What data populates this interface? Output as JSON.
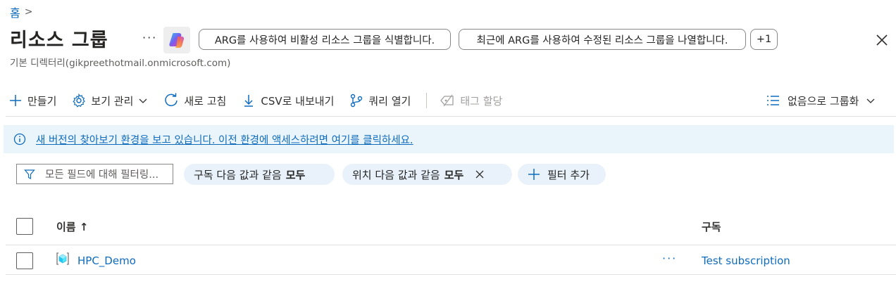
{
  "breadcrumb": {
    "home": "홈",
    "separator": ">"
  },
  "header": {
    "title": "리소스 그룹",
    "more": "···",
    "subtitle": "기본 디렉터리(gikpreethotmail.onmicrosoft.com)",
    "suggestions": [
      "ARG를 사용하여 비활성 리소스 그룹을 식별합니다.",
      "최근에 ARG를 사용하여 수정된 리소스 그룹을 나열합니다.",
      "+1"
    ]
  },
  "toolbar": {
    "create": "만들기",
    "manage_view": "보기 관리",
    "refresh": "새로 고침",
    "export_csv": "CSV로 내보내기",
    "open_query": "쿼리 열기",
    "assign_tags": "태그 할당",
    "group_by": "없음으로 그룹화"
  },
  "banner": {
    "message": "새 버전의 찾아보기 환경을 보고 있습니다. 이전 환경에 액세스하려면 여기를 클릭하세요."
  },
  "filters": {
    "search_placeholder": "모든 필드에 대해 필터링...",
    "chip_subscription_label": "구독 다음 값과 같음",
    "chip_subscription_value": "모두",
    "chip_location_label": "위치 다음 값과 같음",
    "chip_location_value": "모두",
    "add_filter": "필터 추가"
  },
  "table": {
    "columns": {
      "name": "이름 ↑",
      "subscription": "구독"
    },
    "rows": [
      {
        "name": "HPC_Demo",
        "more": "···",
        "subscription": "Test subscription"
      }
    ]
  },
  "colors": {
    "accent": "#0f6cbd",
    "banner_bg": "#eaf4fb",
    "chip_bg": "#e9f2fb"
  }
}
